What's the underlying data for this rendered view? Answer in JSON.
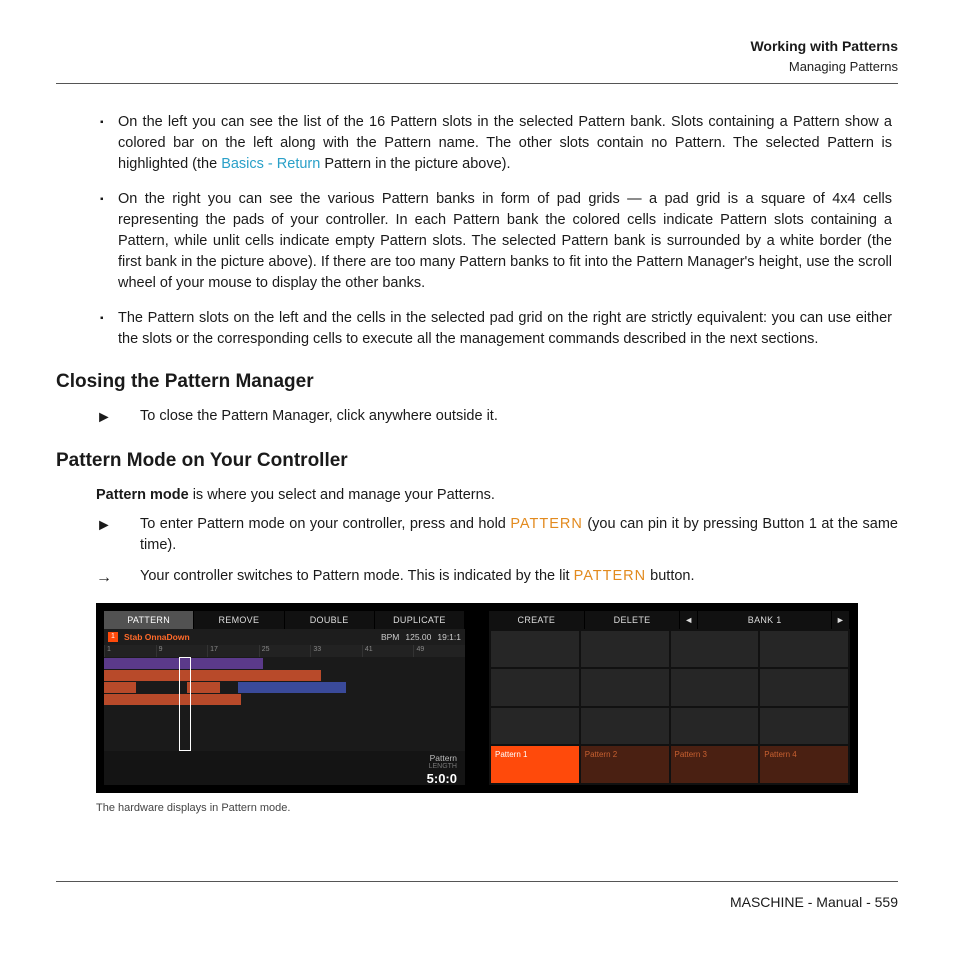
{
  "header": {
    "title": "Working with Patterns",
    "subtitle": "Managing Patterns"
  },
  "bullets": {
    "b1a": "On the left you can see the list of the 16 Pattern slots in the selected Pattern bank. Slots containing a Pattern show a colored bar on the left along with the Pattern name. The other slots contain no Pattern. The selected Pattern is highlighted (the ",
    "b1link": "Basics - Return",
    "b1b": " Pattern in the picture above).",
    "b2": "On the right you can see the various Pattern banks in form of pad grids — a pad grid is a square of 4x4 cells representing the pads of your controller. In each Pattern bank the colored cells indicate Pattern slots containing a Pattern, while unlit cells indicate empty Pattern slots. The selected Pattern bank is surrounded by a white border (the first bank in the picture above). If there are too many Pattern banks to fit into the Pattern Manager's height, use the scroll wheel of your mouse to display the other banks.",
    "b3": "The Pattern slots on the left and the cells in the selected pad grid on the right are strictly equivalent: you can use either the slots or the corresponding cells to execute all the management commands described in the next sections."
  },
  "sections": {
    "closing_title": "Closing the Pattern Manager",
    "closing_text": "To close the Pattern Manager, click anywhere outside it.",
    "mode_title": "Pattern Mode on Your Controller",
    "mode_intro_bold": "Pattern mode",
    "mode_intro_rest": " is where you select and manage your Patterns.",
    "mode_step1a": "To enter Pattern mode on your controller, press and hold ",
    "mode_step1_key": "PATTERN",
    "mode_step1b": " (you can pin it by pressing Button 1 at the same time).",
    "mode_step2a": "Your controller switches to Pattern mode. This is indicated by the lit ",
    "mode_step2_key": "PATTERN",
    "mode_step2b": " button."
  },
  "figure": {
    "left_tabs": {
      "pattern": "PATTERN",
      "remove": "REMOVE",
      "double": "DOUBLE",
      "duplicate": "DUPLICATE"
    },
    "info": {
      "num": "1",
      "name": "Stab OnnaDown",
      "bpm_label": "BPM",
      "bpm": "125.00",
      "time": "19:1:1"
    },
    "ruler": [
      "1",
      "9",
      "17",
      "25",
      "33",
      "41",
      "49"
    ],
    "bottom": {
      "label": "Pattern",
      "sublabel": "LENGTH",
      "value": "5:0:0"
    },
    "right_tabs": {
      "create": "CREATE",
      "delete": "DELETE",
      "left": "◄",
      "bank": "BANK 1",
      "right": "►"
    },
    "pads": {
      "p1": "Pattern 1",
      "p2": "Pattern 2",
      "p3": "Pattern 3",
      "p4": "Pattern 4"
    }
  },
  "caption": "The hardware displays in Pattern mode.",
  "footer": "MASCHINE - Manual - 559"
}
